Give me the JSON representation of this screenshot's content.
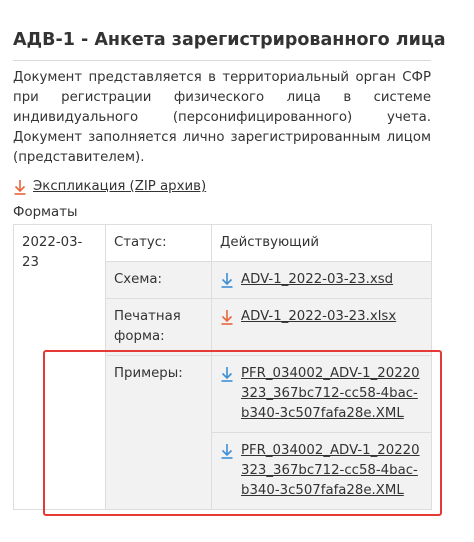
{
  "page": {
    "title": "АДВ-1 - Анкета зарегистрированного лица",
    "description": "Документ представляется в территориальный орган СФР при регистрации физического лица в системе индивидуального (персонифицированного) учета. Документ заполняется лично зарегистрированным лицом (представителем).",
    "explication_link": "Экспликация (ZIP архив)",
    "formats_label": "Форматы"
  },
  "formats": {
    "date": "2022-03-23",
    "status_label": "Статус:",
    "status_value": "Действующий",
    "schema_label": "Схема:",
    "schema_file": "ADV-1_2022-03-23.xsd",
    "print_label": "Печатная форма:",
    "print_file": "ADV-1_2022-03-23.xlsx",
    "examples_label": "Примеры:",
    "examples": [
      "PFR_034002_ADV-1_20220323_367bc712-cc58-4bac-b340-3c507fafa28e.XML",
      "PFR_034002_ADV-1_20220323_367bc712-cc58-4bac-b340-3c507fafa28e.XML"
    ]
  },
  "colors": {
    "icon_orange": "#e8663d",
    "icon_blue": "#3f8fd6",
    "highlight_red": "#e53935"
  }
}
